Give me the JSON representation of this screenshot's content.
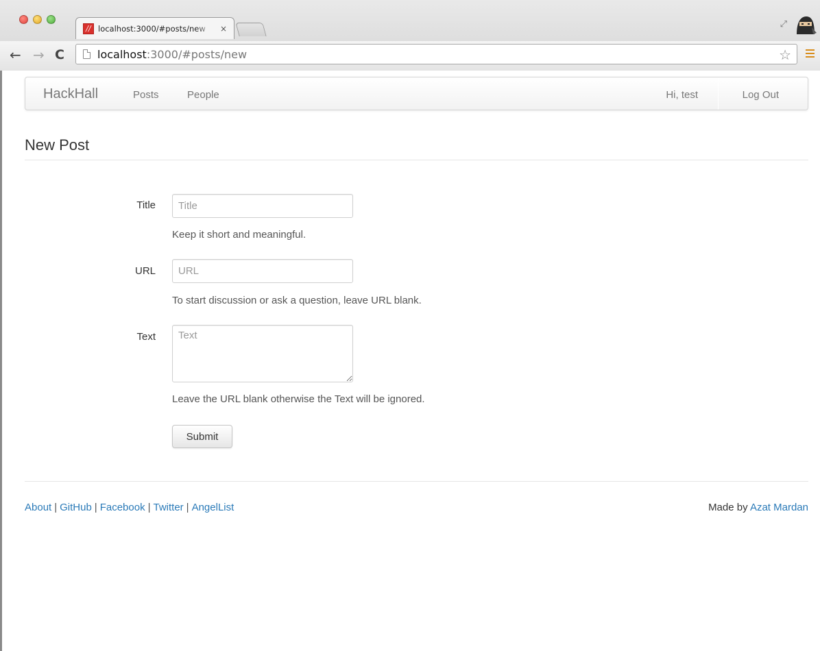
{
  "browser": {
    "tab_title": "localhost:3000/#posts/new",
    "tab_close": "×",
    "url_host": "localhost",
    "url_rest": ":3000/#posts/new",
    "favicon_glyph": "//",
    "icons": [
      "back-arrow-icon",
      "forward-arrow-icon",
      "reload-icon",
      "page-icon",
      "star-icon",
      "menu-icon",
      "fullscreen-icon"
    ]
  },
  "navbar": {
    "brand": "HackHall",
    "links": [
      "Posts",
      "People"
    ],
    "greeting": "Hi, test",
    "logout": "Log Out"
  },
  "page": {
    "title": "New Post"
  },
  "form": {
    "title": {
      "label": "Title",
      "placeholder": "Title",
      "value": "",
      "help": "Keep it short and meaningful."
    },
    "url": {
      "label": "URL",
      "placeholder": "URL",
      "value": "",
      "help": "To start discussion or ask a question, leave URL blank."
    },
    "text": {
      "label": "Text",
      "placeholder": "Text",
      "value": "",
      "help": "Leave the URL blank otherwise the Text will be ignored."
    },
    "submit": "Submit"
  },
  "footer": {
    "links": [
      "About",
      "GitHub",
      "Facebook",
      "Twitter",
      "AngelList"
    ],
    "separator": "|",
    "credit_prefix": "Made by",
    "credit_name": "Azat Mardan"
  },
  "colors": {
    "link": "#2a7ab8",
    "menu_accent": "#d88c1a",
    "favicon": "#d9302c"
  }
}
